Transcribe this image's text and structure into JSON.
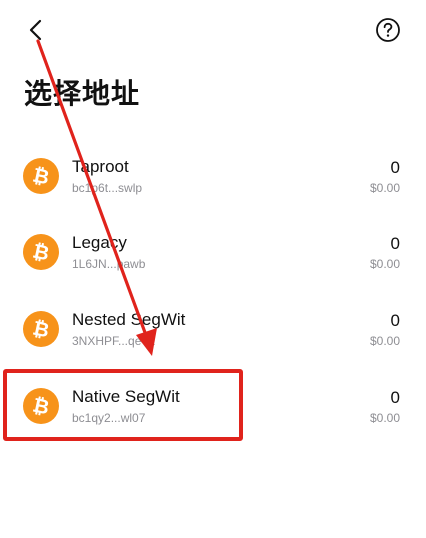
{
  "header": {
    "back_icon": "chevron-left-icon",
    "help_icon": "question-circle-icon",
    "title": "选择地址"
  },
  "colors": {
    "bitcoin_orange": "#f7931a",
    "annotation_red": "#e0231c",
    "secondary_text": "#8e8e93"
  },
  "addresses": [
    {
      "name": "Taproot",
      "short": "bc1p6t...swlp",
      "balance": "0",
      "fiat": "$0.00",
      "icon": "bitcoin-icon"
    },
    {
      "name": "Legacy",
      "short": "1L6JN...pawb",
      "balance": "0",
      "fiat": "$0.00",
      "icon": "bitcoin-icon"
    },
    {
      "name": "Nested SegWit",
      "short": "3NXHPF...qe4a",
      "balance": "0",
      "fiat": "$0.00",
      "icon": "bitcoin-icon"
    },
    {
      "name": "Native SegWit",
      "short": "bc1qy2...wl07",
      "balance": "0",
      "fiat": "$0.00",
      "icon": "bitcoin-icon"
    }
  ]
}
